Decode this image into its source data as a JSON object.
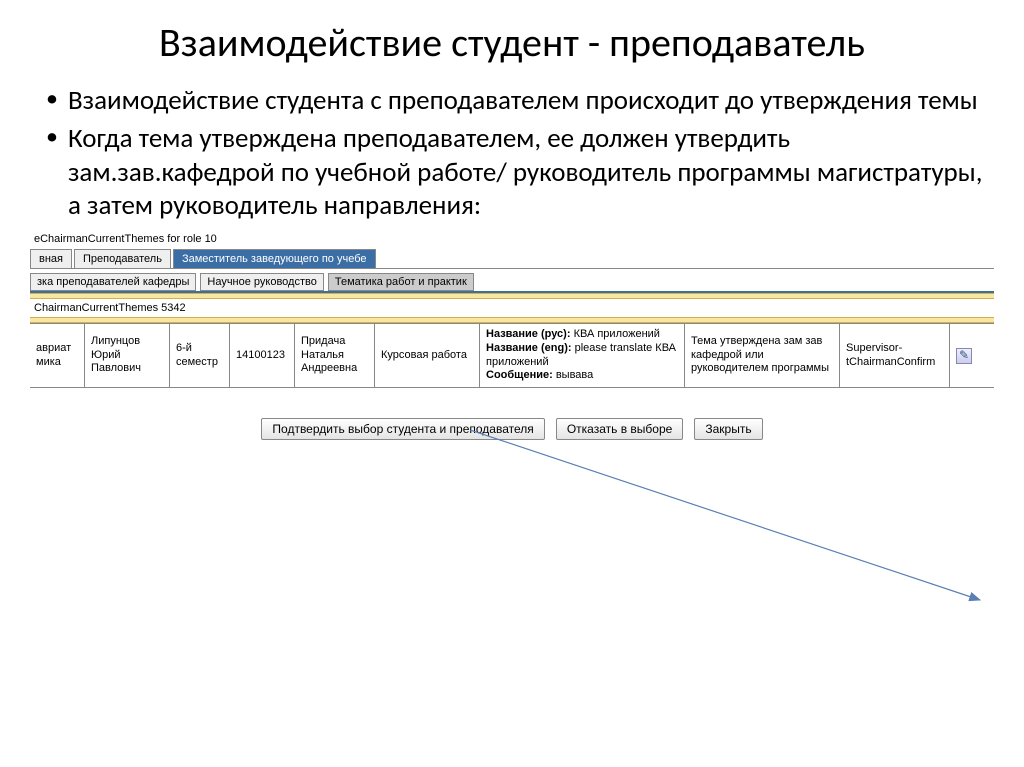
{
  "title": "Взаимодействие студент - преподаватель",
  "bullets": [
    "Взаимодействие студента с преподавателем происходит до утверждения темы",
    "Когда тема утверждена преподавателем, ее должен утвердить зам.зав.кафедрой по учебной работе/ руководитель программы магистратуры, а затем руководитель направления:"
  ],
  "app": {
    "crumb": "eChairmanCurrentThemes for role 10",
    "tabs": [
      "вная",
      "Преподаватель",
      "Заместитель заведующего по учебе"
    ],
    "subtabs": [
      "зка преподавателей кафедры",
      "Научное руководство",
      "Тематика работ и практик"
    ],
    "section": "ChairmanCurrentThemes 5342",
    "row": {
      "c0a": "авриат",
      "c0b": "мика",
      "c1": "Липунцов Юрий Павлович",
      "c2": "6-й семестр",
      "c3": "14100123",
      "c4": "Придача Наталья Андреевна",
      "c5": "Курсовая работа",
      "c6_rus_label": "Название (рус):",
      "c6_rus_val": " КВА приложений",
      "c6_eng_label": "Название (eng):",
      "c6_eng_val": " please translate КВА приложений",
      "c6_msg_label": "Сообщение:",
      "c6_msg_val": " вывава",
      "c7": "Тема утверждена зам зав кафедрой или руководителем программы",
      "c8": "Supervisor-tChairmanConfirm"
    },
    "buttons": {
      "confirm": "Подтвердить выбор студента и преподавателя",
      "reject": "Отказать в выборе",
      "close": "Закрыть"
    }
  }
}
